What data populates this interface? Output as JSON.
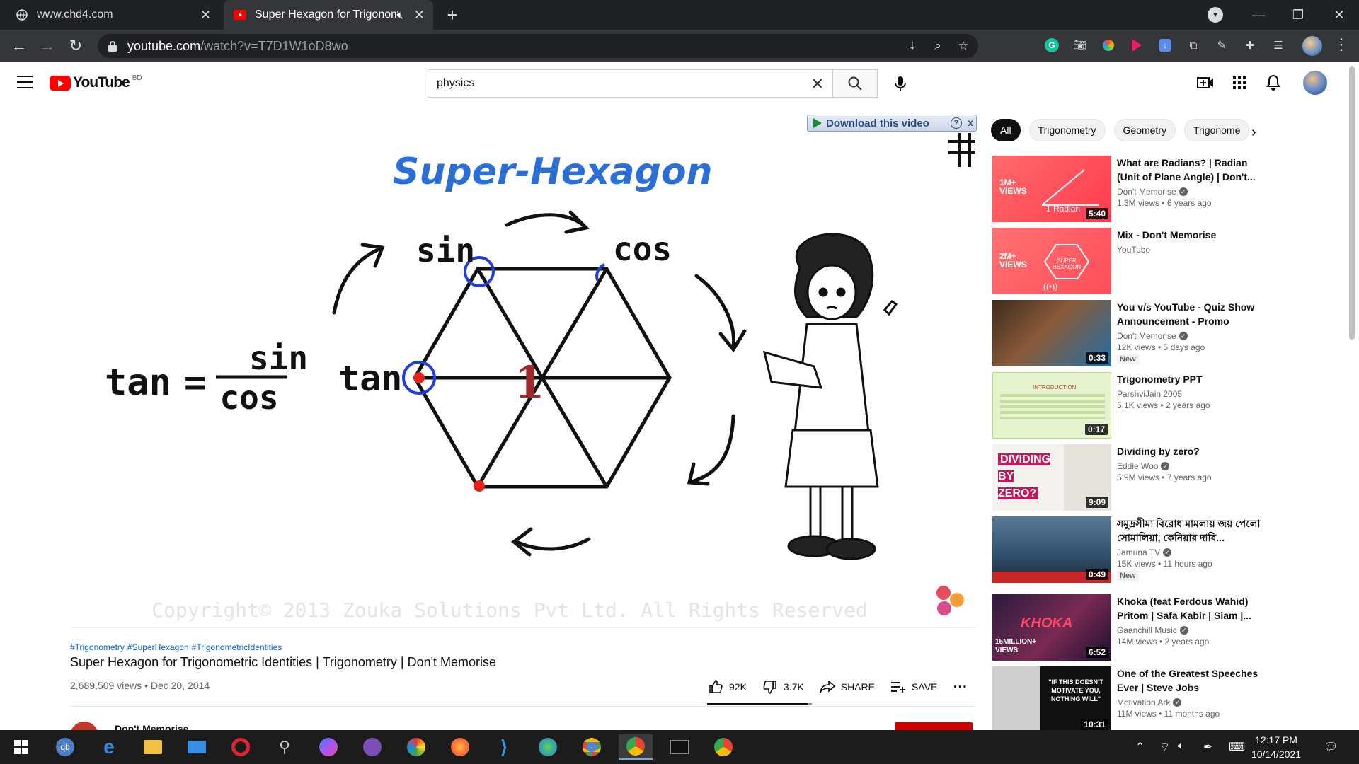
{
  "browser": {
    "tabs": [
      {
        "title": "www.chd4.com"
      },
      {
        "title": "Super Hexagon for Trigonom"
      }
    ],
    "url_host": "youtube.com",
    "url_path": "/watch?v=T7D1W1oD8wo"
  },
  "header": {
    "logo_text": "YouTube",
    "country_code": "BD",
    "search_value": "physics",
    "search_placeholder": "Search"
  },
  "player": {
    "download_bar_label": "Download this video",
    "download_help": "?",
    "download_close": "x",
    "video_frame": {
      "heading": "Super-Hexagon",
      "formula_lhs": "tan",
      "formula_eq": "=",
      "formula_num": "sin",
      "formula_den": "cos",
      "vertex_sin": "sin",
      "vertex_cos": "cos",
      "vertex_tan": "tan",
      "center_label": "1",
      "copyright": "Copyright© 2013 Zouka Solutions Pvt Ltd. All Rights Reserved"
    }
  },
  "video": {
    "hashtags": [
      "#Trigonometry",
      "#SuperHexagon",
      "#TrigonometricIdentities"
    ],
    "title": "Super Hexagon for Trigonometric Identities | Trigonometry | Don't Memorise",
    "meta": "2,689,509 views • Dec 20, 2014",
    "likes": "92K",
    "dislikes": "3.7K",
    "share_label": "SHARE",
    "save_label": "SAVE",
    "like_ratio": 0.96,
    "channel_peek": "Don't Memorise"
  },
  "sidebar": {
    "chips": [
      "All",
      "Trigonometry",
      "Geometry",
      "Trigonome"
    ],
    "recommendations": [
      {
        "title": "What are Radians? | Radian (Unit of Plane Angle) | Don't...",
        "channel": "Don't Memorise",
        "verified": true,
        "meta": "1.3M views • 6 years ago",
        "duration": "5:40",
        "badge": "1M+\nVIEWS",
        "thumb_text": "1 Radian",
        "new": false
      },
      {
        "title": "Mix - Don't Memorise",
        "channel": "YouTube",
        "verified": false,
        "meta": "",
        "duration": "",
        "badge": "2M+\nVIEWS",
        "thumb_text": "SUPER HEXAGON",
        "new": false
      },
      {
        "title": "You v/s YouTube - Quiz Show Announcement - Promo",
        "channel": "Don't Memorise",
        "verified": true,
        "meta": "12K views • 5 days ago",
        "duration": "0:33",
        "badge": "",
        "thumb_text": "",
        "new": true
      },
      {
        "title": "Trigonometry PPT",
        "channel": "ParshviJain 2005",
        "verified": false,
        "meta": "5.1K views • 2 years ago",
        "duration": "0:17",
        "badge": "",
        "thumb_text": "INTRODUCTION",
        "new": false
      },
      {
        "title": "Dividing by zero?",
        "channel": "Eddie Woo",
        "verified": true,
        "meta": "5.9M views • 7 years ago",
        "duration": "9:09",
        "badge": "",
        "thumb_text": "DIVIDING BY ZERO?",
        "new": false
      },
      {
        "title": "সমুদ্রসীমা বিরোধ মামলায় জয় পেলো সোমালিয়া, কেনিয়ার দাবি...",
        "channel": "Jamuna TV",
        "verified": true,
        "meta": "15K views • 11 hours ago",
        "duration": "0:49",
        "badge": "",
        "thumb_text": "",
        "new": true
      },
      {
        "title": "Khoka (feat Ferdous Wahid) Pritom | Safa Kabir | Siam |...",
        "channel": "Gaanchill Music",
        "verified": true,
        "meta": "14M views • 2 years ago",
        "duration": "6:52",
        "badge": "15MILLION+\nVIEWS",
        "thumb_text": "KHOKA",
        "new": false
      },
      {
        "title": "One of the Greatest Speeches Ever | Steve Jobs",
        "channel": "Motivation Ark",
        "verified": true,
        "meta": "11M views • 11 months ago",
        "duration": "10:31",
        "badge": "",
        "thumb_text": "\"IF THIS DOESN'T MOTIVATE YOU, NOTHING WILL\"",
        "new": false
      }
    ],
    "new_label": "New"
  },
  "taskbar": {
    "time": "12:17 PM",
    "date": "10/14/2021"
  },
  "colors": {
    "yt_red": "#ff0000",
    "link_blue": "#065fd4",
    "hex_blue": "#2b6fd6",
    "tab_bar": "#202124",
    "toolbar": "#35363a"
  }
}
